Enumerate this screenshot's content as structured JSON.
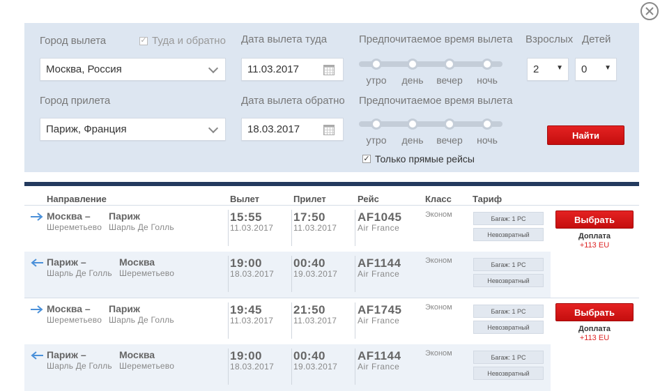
{
  "search": {
    "departure_city_label": "Город вылета",
    "departure_city_value": "Москва, Россия",
    "round_trip_label": "Туда и обратно",
    "arrival_city_label": "Город прилета",
    "arrival_city_value": "Париж, Франция",
    "depart_date_label": "Дата вылета туда",
    "depart_date_value": "11.03.2017",
    "return_date_label": "Дата вылета обратно",
    "return_date_value": "18.03.2017",
    "pref_time_label_1": "Предпочитаемое время вылета",
    "pref_time_label_2": "Предпочитаемое время вылета",
    "time_options": [
      "утро",
      "день",
      "вечер",
      "ночь"
    ],
    "adults_label": "Взрослых",
    "adults_value": "2",
    "children_label": "Детей",
    "children_value": "0",
    "direct_only_label": "Только прямые рейсы",
    "find_button": "Найти"
  },
  "table": {
    "headers": {
      "direction": "Направление",
      "depart": "Вылет",
      "arrive": "Прилет",
      "flight": "Рейс",
      "class": "Класс",
      "tariff": "Тариф"
    },
    "offers": [
      {
        "outbound": {
          "from_city": "Москва –",
          "to_city": "Париж",
          "from_airport": "Шереметьево",
          "to_airport": "Шарль Де Голль",
          "dep_time": "15:55",
          "dep_date": "11.03.2017",
          "arr_time": "17:50",
          "arr_date": "11.03.2017",
          "flight_no": "AF1045",
          "airline": "Air France",
          "class": "Эконом",
          "tariff_1": "Багаж: 1 PC",
          "tariff_2": "Невозвратный"
        },
        "return": {
          "from_city": "Париж –",
          "to_city": "Москва",
          "from_airport": "Шарль Де Голль",
          "to_airport": "Шереметьево",
          "dep_time": "19:00",
          "dep_date": "18.03.2017",
          "arr_time": "00:40",
          "arr_date": "19.03.2017",
          "flight_no": "AF1144",
          "airline": "Air France",
          "class": "Эконом",
          "tariff_1": "Багаж: 1 PC",
          "tariff_2": "Невозвратный"
        },
        "select_button": "Выбрать",
        "extra_label": "Доплата",
        "extra_value": "+113 EU"
      },
      {
        "outbound": {
          "from_city": "Москва –",
          "to_city": "Париж",
          "from_airport": "Шереметьево",
          "to_airport": "Шарль Де Голль",
          "dep_time": "19:45",
          "dep_date": "11.03.2017",
          "arr_time": "21:50",
          "arr_date": "11.03.2017",
          "flight_no": "AF1745",
          "airline": "Air France",
          "class": "Эконом",
          "tariff_1": "Багаж: 1 PC",
          "tariff_2": "Невозвратный"
        },
        "return": {
          "from_city": "Париж –",
          "to_city": "Москва",
          "from_airport": "Шарль Де Голль",
          "to_airport": "Шереметьево",
          "dep_time": "19:00",
          "dep_date": "18.03.2017",
          "arr_time": "00:40",
          "arr_date": "19.03.2017",
          "flight_no": "AF1144",
          "airline": "Air France",
          "class": "Эконом",
          "tariff_1": "Багаж: 1 PC",
          "tariff_2": "Невозвратный"
        },
        "select_button": "Выбрать",
        "extra_label": "Доплата",
        "extra_value": "+113 EU"
      }
    ]
  },
  "icons": {
    "close": "close-icon",
    "chevron": "chevron-down-icon",
    "calendar": "calendar-icon",
    "arrow_out": "arrow-right-icon",
    "arrow_ret": "arrow-left-icon"
  },
  "colors": {
    "accent_red": "#d81818",
    "panel_bg": "#dde6f1",
    "header_bar": "#233a5e",
    "arrow_blue": "#4a90d9"
  }
}
